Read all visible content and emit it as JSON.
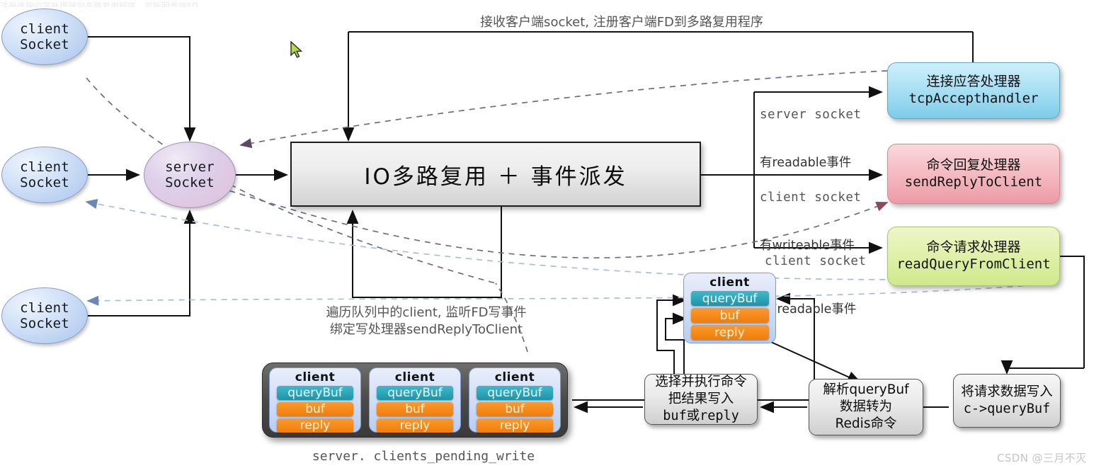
{
  "diagram": {
    "title_top": "接收客户端socket, 注册客户端FD到多路复用程序",
    "center_box": "IO多路复用 ＋ 事件派发",
    "caption_mid": "遍历队列中的client, 监听FD写事件\n绑定写处理器sendReplyToClient",
    "caption_list": "server. clients_pending_write",
    "watermark": "CSDN @三月不灭",
    "top_clipped_text": "注册连接应答处理器到多路复用程序，监听服务端FD"
  },
  "sockets": {
    "client1": {
      "line1": "client",
      "line2": "Socket"
    },
    "client2": {
      "line1": "client",
      "line2": "Socket"
    },
    "client3": {
      "line1": "client",
      "line2": "Socket"
    },
    "server": {
      "line1": "server",
      "line2": "Socket"
    }
  },
  "edge_labels": [
    {
      "mono": "server socket",
      "cn": "有readable事件"
    },
    {
      "mono": "client socket",
      "cn": "有writeable事件"
    },
    {
      "mono": "client socket",
      "cn": "有readable事件"
    }
  ],
  "handlers": [
    {
      "cn": "连接应答处理器",
      "fn": "tcpAccepthandler",
      "color": "#9fdcf2"
    },
    {
      "cn": "命令回复处理器",
      "fn": "sendReplyToClient",
      "color": "#f3b4bc"
    },
    {
      "cn": "命令请求处理器",
      "fn": "readQueryFromClient",
      "color": "#dcefa2"
    }
  ],
  "client_struct": {
    "title": "client",
    "fields": [
      "queryBuf",
      "buf",
      "reply"
    ]
  },
  "pending_clients": [
    {
      "title": "client",
      "fields": [
        "queryBuf",
        "buf",
        "reply"
      ]
    },
    {
      "title": "client",
      "fields": [
        "queryBuf",
        "buf",
        "reply"
      ]
    },
    {
      "title": "client",
      "fields": [
        "queryBuf",
        "buf",
        "reply"
      ]
    }
  ],
  "process_boxes": [
    {
      "lines": [
        "选择并执行命令",
        "把结果写入",
        "buf或reply"
      ],
      "mono_lines": [
        false,
        false,
        true
      ]
    },
    {
      "lines": [
        "解析queryBuf",
        "数据转为",
        "Redis命令"
      ],
      "mono_lines": [
        false,
        false,
        false
      ]
    },
    {
      "lines": [
        "将请求数据写入",
        "c->queryBuf"
      ],
      "mono_lines": [
        false,
        true
      ]
    }
  ],
  "colors": {
    "accent_orange": "#f07d0a",
    "accent_teal": "#1f93a8",
    "solid_edge": "#111111",
    "dashed_gray": "#6b6f7d",
    "dashed_blue": "#a9bdd8",
    "cursor": "#b4d94a"
  }
}
